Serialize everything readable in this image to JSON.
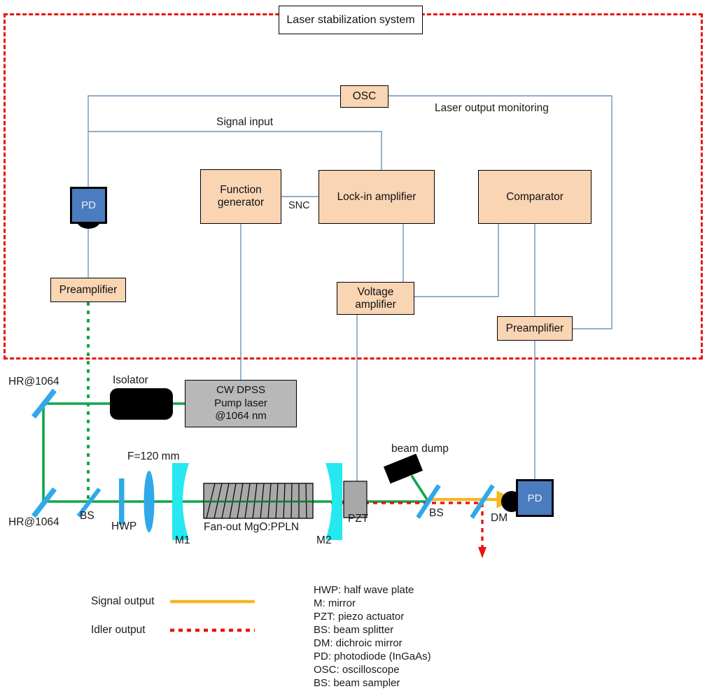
{
  "title_box": {
    "label": "Laser stabilization system"
  },
  "electronics": {
    "osc": {
      "label": "OSC"
    },
    "function_generator": {
      "label": "Function\ngenerator"
    },
    "lock_in_amplifier": {
      "label": "Lock-in amplifier"
    },
    "comparator": {
      "label": "Comparator"
    },
    "voltage_amplifier": {
      "label": "Voltage\namplifier"
    },
    "preamplifier_left": {
      "label": "Preamplifier"
    },
    "preamplifier_right": {
      "label": "Preamplifier"
    },
    "pd_left": {
      "label": "PD"
    },
    "wire_labels": {
      "signal_input": "Signal input",
      "laser_output_monitoring": "Laser output monitoring",
      "snc": "SNC"
    }
  },
  "optics": {
    "pump_laser": {
      "label": "CW DPSS\nPump laser\n@1064 nm"
    },
    "isolator": {
      "label": "Isolator"
    },
    "mirror_top": {
      "label": "HR@1064"
    },
    "mirror_bottom": {
      "label": "HR@1064"
    },
    "beam_splitter_left": {
      "label": "BS"
    },
    "hwp": {
      "label": "HWP"
    },
    "lens": {
      "label": "F=120 mm"
    },
    "m1": {
      "label": "M1"
    },
    "crystal": {
      "label": "Fan-out MgO:PPLN"
    },
    "m2": {
      "label": "M2"
    },
    "pzt": {
      "label": "PZT"
    },
    "beam_dump": {
      "label": "beam dump"
    },
    "beam_sampler": {
      "label": "BS"
    },
    "dichroic_mirror": {
      "label": "DM"
    },
    "pd_right": {
      "label": "PD"
    }
  },
  "legend": {
    "entries": [
      {
        "label": "Signal output",
        "style": "solid",
        "color": "#f5b820"
      },
      {
        "label": "Idler output",
        "style": "dotted",
        "color": "#e8140f"
      }
    ]
  },
  "abbreviations": [
    "HWP: half wave plate",
    "M: mirror",
    "PZT: piezo actuator",
    "BS: beam splitter",
    "DM: dichroic mirror",
    "PD: photodiode (InGaAs)",
    "OSC: oscilloscope",
    "BS: beam sampler"
  ],
  "colors": {
    "box_fill": "#fad5b4",
    "wire": "#6f93b8",
    "pump_beam": "#0fa64a",
    "signal_beam": "#f5b820",
    "idler_beam": "#e8140f",
    "optic_blue": "#2fa9e8",
    "mirror_cyan": "#25e8f0",
    "frame_red": "#e8140f",
    "pd_blue": "#4b7cbf"
  }
}
